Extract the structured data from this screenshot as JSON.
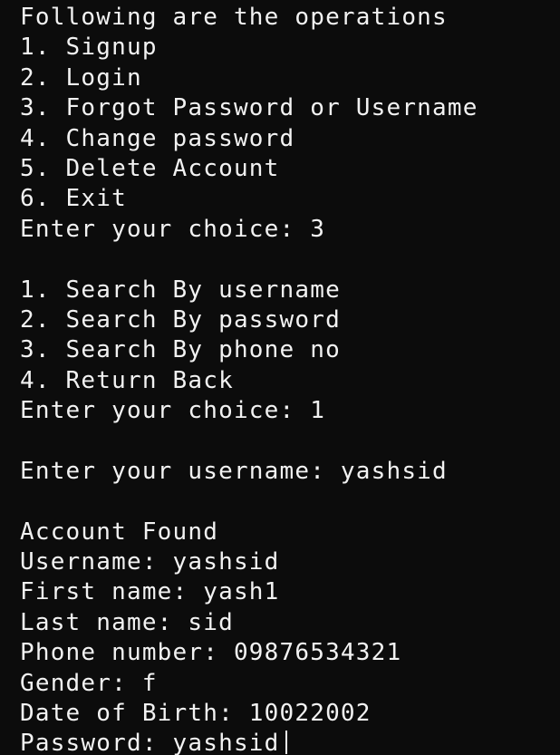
{
  "terminal": {
    "lines": [
      "Following are the operations",
      "1. Signup",
      "2. Login",
      "3. Forgot Password or Username",
      "4. Change password",
      "5. Delete Account",
      "6. Exit",
      "Enter your choice: 3",
      "",
      "1. Search By username",
      "2. Search By password",
      "3. Search By phone no",
      "4. Return Back",
      "Enter your choice: 1",
      "",
      "Enter your username: yashsid",
      "",
      "Account Found",
      "Username: yashsid",
      "First name: yash1",
      "Last name: sid",
      "Phone number: 09876534321",
      "Gender: f",
      "Date of Birth: 10022002",
      "Password: yashsid"
    ]
  },
  "colors": {
    "background": "#0c0c0c",
    "foreground": "#f2f2f2"
  }
}
